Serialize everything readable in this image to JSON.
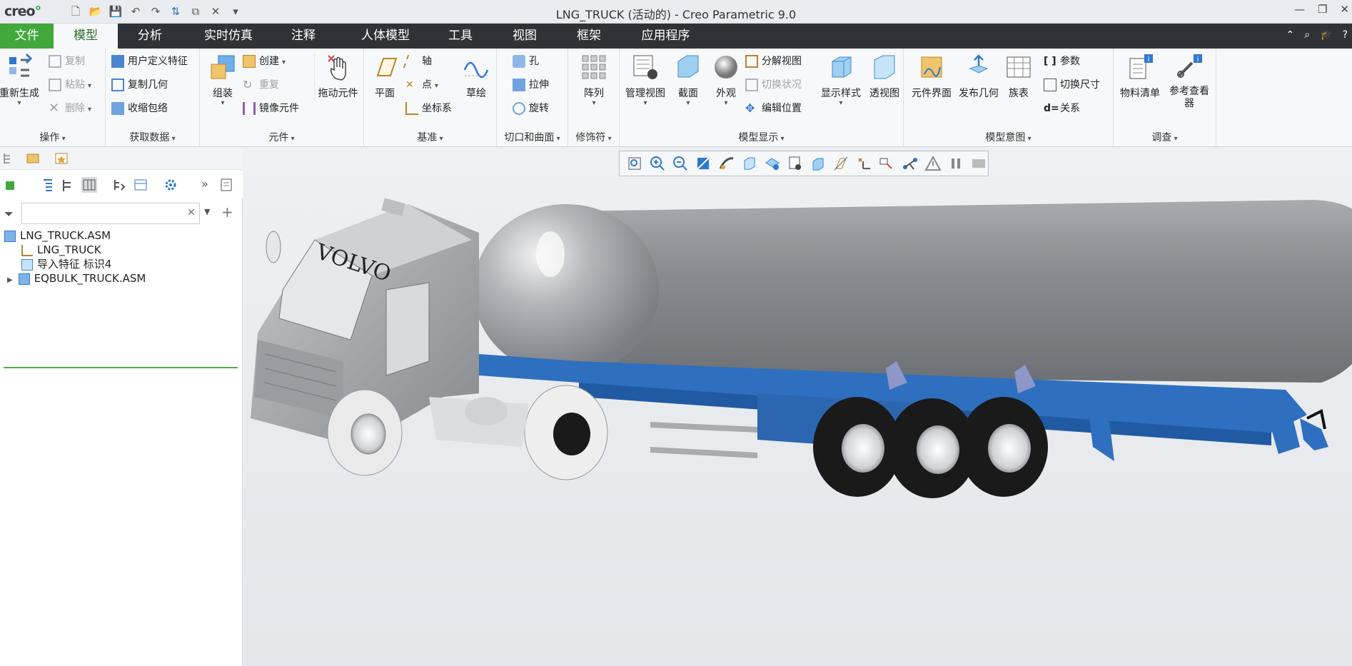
{
  "window": {
    "app_logo": "creo",
    "title": "LNG_TRUCK (活动的) - Creo Parametric 9.0",
    "controls": [
      "minimize-icon",
      "restore-icon",
      "close-icon"
    ]
  },
  "quick_access": [
    "new-icon",
    "open-icon",
    "save-icon",
    "undo-icon",
    "redo-icon",
    "regenerate-icon",
    "windows-icon",
    "close-window-icon",
    "customize-icon"
  ],
  "menu": {
    "tabs": [
      "文件",
      "模型",
      "分析",
      "实时仿真",
      "注释",
      "人体模型",
      "工具",
      "视图",
      "框架",
      "应用程序"
    ],
    "active": "模型"
  },
  "ribbon": {
    "operations": {
      "label": "操作",
      "regenerate": "重新生成",
      "copy": "复制",
      "paste": "粘贴",
      "delete": "删除"
    },
    "get_data": {
      "label": "获取数据",
      "udf": "用户定义特征",
      "copy_geom": "复制几何",
      "shrinkwrap": "收缩包络"
    },
    "components": {
      "label": "元件",
      "assemble": "组装",
      "create": "创建",
      "repeat": "重复",
      "mirror": "镜像元件",
      "drag": "拖动元件"
    },
    "datum": {
      "label": "基准",
      "plane": "平面",
      "axis": "轴",
      "point": "点",
      "csys": "坐标系",
      "sketch": "草绘"
    },
    "cut_surface": {
      "label": "切口和曲面",
      "hole": "孔",
      "extrude": "拉伸",
      "revolve": "旋转"
    },
    "modifiers": {
      "label": "修饰符",
      "pattern": "阵列"
    },
    "model_display": {
      "label": "模型显示",
      "manage_views": "管理视图",
      "section": "截面",
      "appearance": "外观",
      "exploded": "分解视图",
      "toggle_status": "切换状况",
      "edit_position": "编辑位置",
      "display_style": "显示样式",
      "perspective": "透视图"
    },
    "model_intent": {
      "label": "模型意图",
      "component_interface": "元件界面",
      "publish_geom": "发布几何",
      "family_table": "族表",
      "parameters": "参数",
      "switch_dims": "切换尺寸",
      "relations": "关系"
    },
    "investigate": {
      "label": "调查",
      "bom": "物料清单",
      "ref_viewer": "参考查看器"
    }
  },
  "model_tree": {
    "search_placeholder": "",
    "nodes": [
      {
        "label": "LNG_TRUCK.ASM",
        "icon": "assembly-icon"
      },
      {
        "label": "LNG_TRUCK",
        "icon": "csys-icon"
      },
      {
        "label": "导入特征 标识4",
        "icon": "import-feature-icon"
      },
      {
        "label": "EQBULK_TRUCK.ASM",
        "icon": "assembly-icon"
      }
    ]
  },
  "graphics_toolbar": [
    "refit-icon",
    "zoom-in-icon",
    "zoom-out-icon",
    "repaint-icon",
    "display-style-icon",
    "saved-orientations-icon",
    "view-manager-icon",
    "perspective-icon",
    "section-icon",
    "datum-display-icon",
    "spin-center-icon",
    "annotation-display-icon",
    "csys-display-icon",
    "warning-icon",
    "pause-icon",
    "animation-icon"
  ],
  "model": {
    "cab_brand": "VOLVO"
  },
  "colors": {
    "accent_green": "#42a83c",
    "menubar": "#2f3338",
    "trailer_blue": "#2f6fbf"
  }
}
